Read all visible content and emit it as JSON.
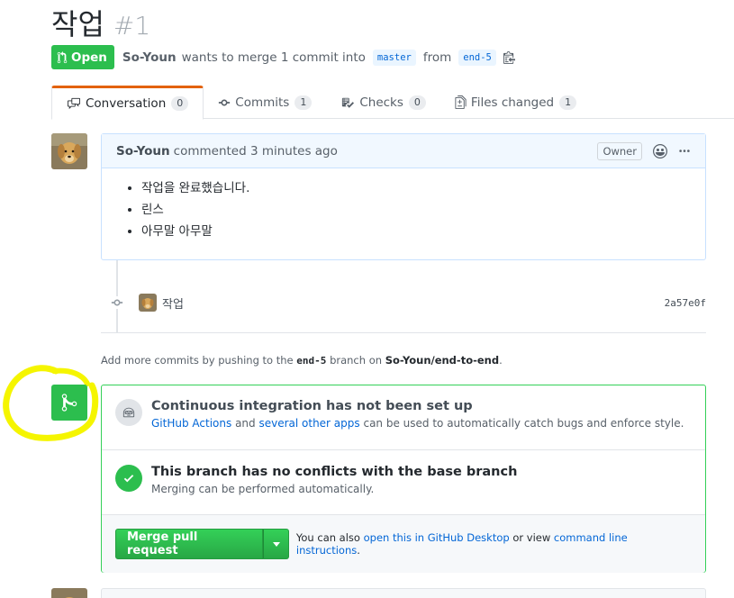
{
  "pr": {
    "title": "작업",
    "number": "#1",
    "state": "Open",
    "author": "So-Youn",
    "meta_text_1": "wants to merge 1 commit into",
    "base_branch": "master",
    "meta_text_2": "from",
    "head_branch": "end-5"
  },
  "tabs": [
    {
      "label": "Conversation",
      "count": "0",
      "icon": "comment-discussion-icon"
    },
    {
      "label": "Commits",
      "count": "1",
      "icon": "git-commit-icon"
    },
    {
      "label": "Checks",
      "count": "0",
      "icon": "checklist-icon"
    },
    {
      "label": "Files changed",
      "count": "1",
      "icon": "file-diff-icon"
    }
  ],
  "comment": {
    "author": "So-Youn",
    "action": "commented 3 minutes ago",
    "role_label": "Owner",
    "items": [
      "작업을 완료했습니다.",
      "린스",
      "아무말 아무말"
    ]
  },
  "commit": {
    "message": "작업",
    "sha": "2a57e0f"
  },
  "push_hint": {
    "prefix": "Add more commits by pushing to the",
    "branch": "end-5",
    "middle": "branch on",
    "repo": "So-Youn/end-to-end",
    "suffix": "."
  },
  "merge_box": {
    "ci_title": "Continuous integration has not been set up",
    "ci_link1": "GitHub Actions",
    "ci_text1": "and",
    "ci_link2": "several other apps",
    "ci_text2": "can be used to automatically catch bugs and enforce style.",
    "conflict_title": "This branch has no conflicts with the base branch",
    "conflict_desc": "Merging can be performed automatically.",
    "merge_button": "Merge pull request",
    "also_prefix": "You can also",
    "also_link1": "open this in GitHub Desktop",
    "also_mid": "or view",
    "also_link2": "command line instructions",
    "also_suffix": "."
  },
  "colors": {
    "green": "#2cbe4e",
    "link": "#0366d6",
    "highlight": "#f5f500",
    "tab_accent": "#e36209"
  }
}
